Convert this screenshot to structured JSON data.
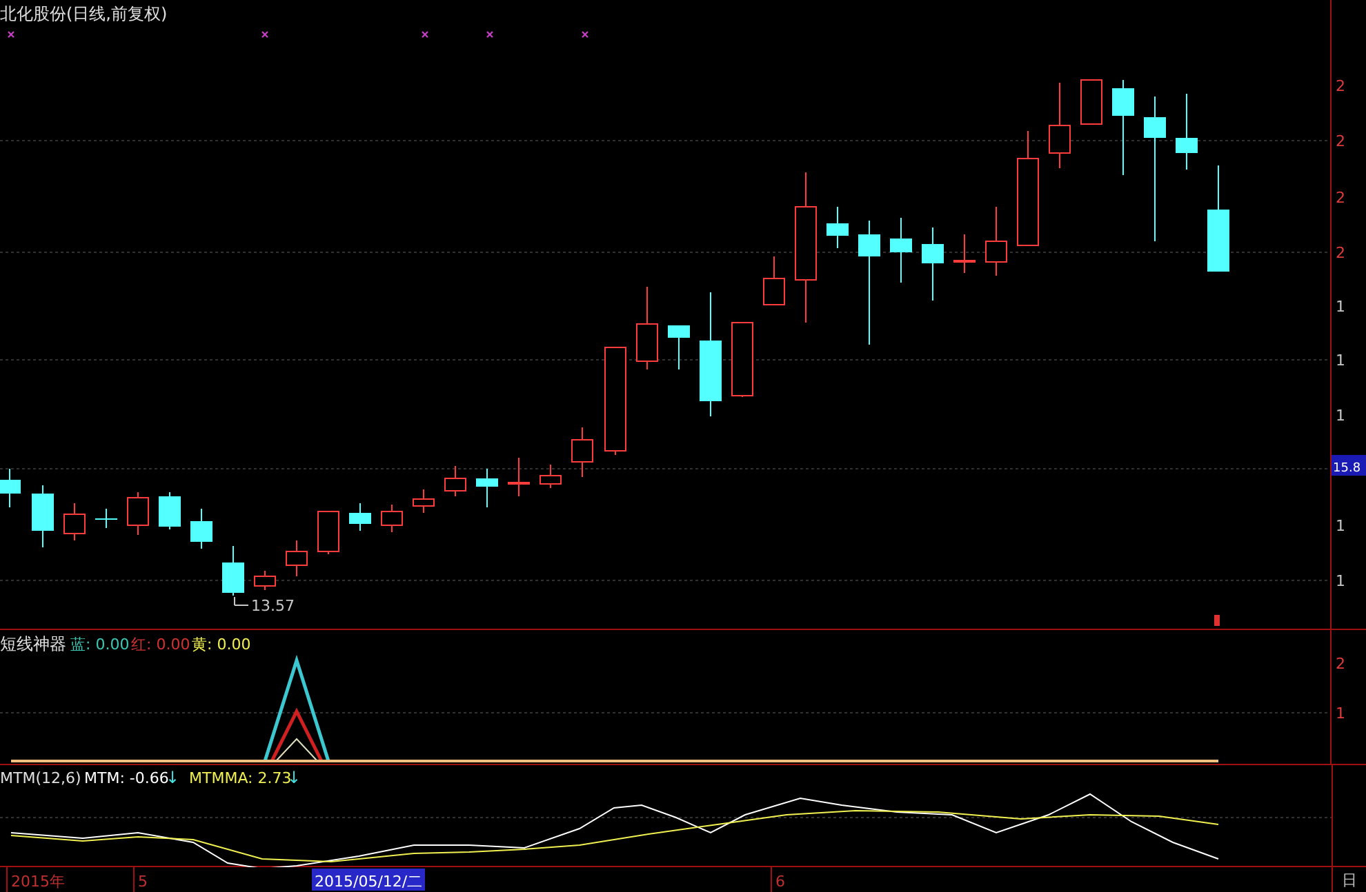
{
  "title": "北化股份(日线,前复权)",
  "price_axis": [
    {
      "text": "2",
      "kind": "up"
    },
    {
      "text": "2",
      "kind": "up"
    },
    {
      "text": "2",
      "kind": "up"
    },
    {
      "text": "2",
      "kind": "up"
    },
    {
      "text": "1",
      "kind": "down"
    },
    {
      "text": "1",
      "kind": "down"
    },
    {
      "text": "1",
      "kind": "down"
    },
    {
      "text": "15.8",
      "kind": "current"
    },
    {
      "text": "1",
      "kind": "down"
    },
    {
      "text": "1",
      "kind": "down"
    }
  ],
  "low_label": "13.57",
  "indicator_1": {
    "name": "短线神器",
    "readings": [
      {
        "text": "蓝: 0.00",
        "color": "#3cc8b4"
      },
      {
        "text": "红: 0.00",
        "color": "#d23232"
      },
      {
        "text": "黄: 0.00",
        "color": "#f0f050"
      }
    ],
    "axis": [
      "2",
      "1"
    ]
  },
  "indicator_2": {
    "name": "MTM(12,6)",
    "readings": [
      {
        "text": "MTM: -0.66",
        "arrow": "↓",
        "color": "#ffffff"
      },
      {
        "text": "MTMMA: 2.73",
        "arrow": "↓",
        "color": "#f0f050"
      }
    ]
  },
  "time_axis": [
    {
      "text": "2015年",
      "kind": "tick"
    },
    {
      "text": "5",
      "kind": "tick"
    },
    {
      "text": "2015/05/12/二",
      "kind": "cursor"
    },
    {
      "text": "6",
      "kind": "tick"
    }
  ],
  "period": "日"
}
